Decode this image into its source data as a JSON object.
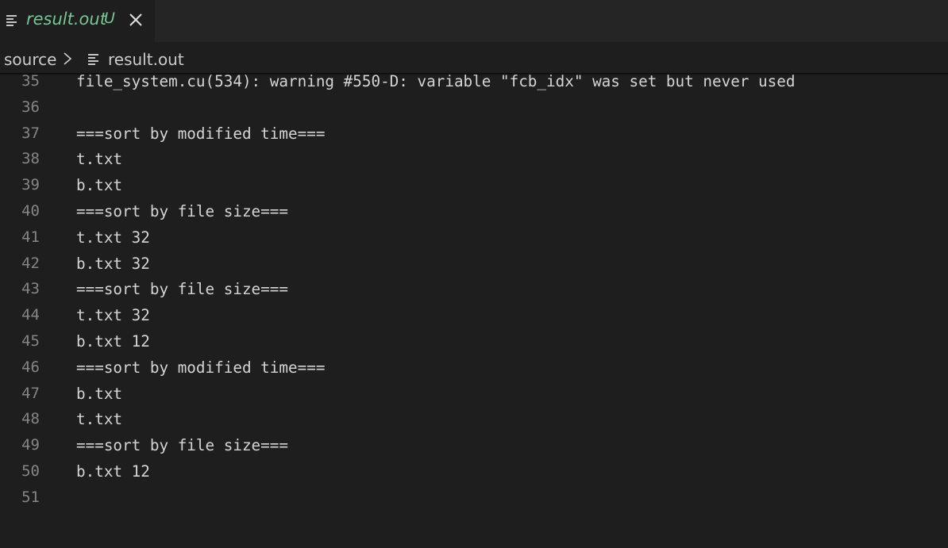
{
  "tab": {
    "title": "result.out",
    "status": "U",
    "icon": "lines-file-icon",
    "close_icon": "close-icon"
  },
  "breadcrumb": {
    "folder": "source",
    "file": "result.out"
  },
  "editor": {
    "lines": [
      {
        "number": "35",
        "text": "file_system.cu(534): warning #550-D: variable \"fcb_idx\" was set but never used"
      },
      {
        "number": "36",
        "text": ""
      },
      {
        "number": "37",
        "text": "===sort by modified time==="
      },
      {
        "number": "38",
        "text": "t.txt"
      },
      {
        "number": "39",
        "text": "b.txt"
      },
      {
        "number": "40",
        "text": "===sort by file size==="
      },
      {
        "number": "41",
        "text": "t.txt 32"
      },
      {
        "number": "42",
        "text": "b.txt 32"
      },
      {
        "number": "43",
        "text": "===sort by file size==="
      },
      {
        "number": "44",
        "text": "t.txt 32"
      },
      {
        "number": "45",
        "text": "b.txt 12"
      },
      {
        "number": "46",
        "text": "===sort by modified time==="
      },
      {
        "number": "47",
        "text": "b.txt"
      },
      {
        "number": "48",
        "text": "t.txt"
      },
      {
        "number": "49",
        "text": "===sort by file size==="
      },
      {
        "number": "50",
        "text": "b.txt 12"
      },
      {
        "number": "51",
        "text": ""
      }
    ]
  },
  "colors": {
    "editor_background": "#1e1e1e",
    "tab_strip_background": "#252526",
    "untracked_green": "#73c991",
    "line_number_gray": "#858585",
    "text_foreground": "#d4d4d4"
  }
}
